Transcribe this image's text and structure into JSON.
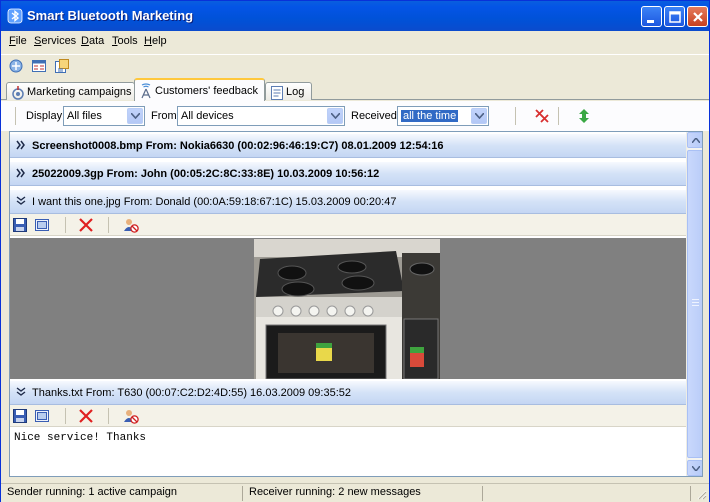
{
  "window": {
    "title": "Smart Bluetooth Marketing",
    "icon": "bluetooth-icon"
  },
  "menu": [
    {
      "label": "File",
      "u": "F",
      "rest": "ile"
    },
    {
      "label": "Services",
      "u": "S",
      "rest": "ervices"
    },
    {
      "label": "Data",
      "u": "D",
      "rest": "ata"
    },
    {
      "label": "Tools",
      "u": "T",
      "rest": "ools"
    },
    {
      "label": "Help",
      "u": "H",
      "rest": "elp"
    }
  ],
  "toolbar_icons": [
    "services-icon",
    "table-icon",
    "export-icon"
  ],
  "tabs": [
    {
      "label": "Marketing campaigns",
      "icon": "campaign-icon",
      "active": false
    },
    {
      "label": "Customers' feedback",
      "icon": "antenna-icon",
      "active": true
    },
    {
      "label": "Log",
      "icon": "log-icon",
      "active": false
    }
  ],
  "filters": {
    "display_label": "Display",
    "display_value": "All files",
    "from_label": "From",
    "from_value": "All devices",
    "received_label": "Received",
    "received_value": "all the time"
  },
  "filter_actions": [
    "delete-all-icon",
    "expand-all-icon"
  ],
  "feedback_items": [
    {
      "text": "Screenshot0008.bmp From: Nokia6630 (00:02:96:46:19:C7) 08.01.2009 12:54:16",
      "expanded": false
    },
    {
      "text": "25022009.3gp From: John (00:05:2C:8C:33:8E) 10.03.2009 10:56:12",
      "expanded": false
    },
    {
      "text": "I want this one.jpg From: Donald (00:0A:59:18:67:1C) 15.03.2009 00:20:47",
      "expanded": true
    },
    {
      "text": "Thanks.txt From: T630 (00:07:C2:D2:4D:55) 16.03.2009 09:35:52",
      "expanded": true
    }
  ],
  "item_toolbar_icons": [
    "save-icon",
    "open-icon",
    "delete-icon",
    "block-sender-icon"
  ],
  "text_message": "Nice service! Thanks",
  "status": {
    "sender": "Sender running: 1 active campaign",
    "receiver": "Receiver running: 2 new messages"
  },
  "colors": {
    "titlebar": "#0454e6",
    "header_gradient_end": "#c4d6f3",
    "image_bg": "#808080",
    "selection": "#316ac5"
  }
}
